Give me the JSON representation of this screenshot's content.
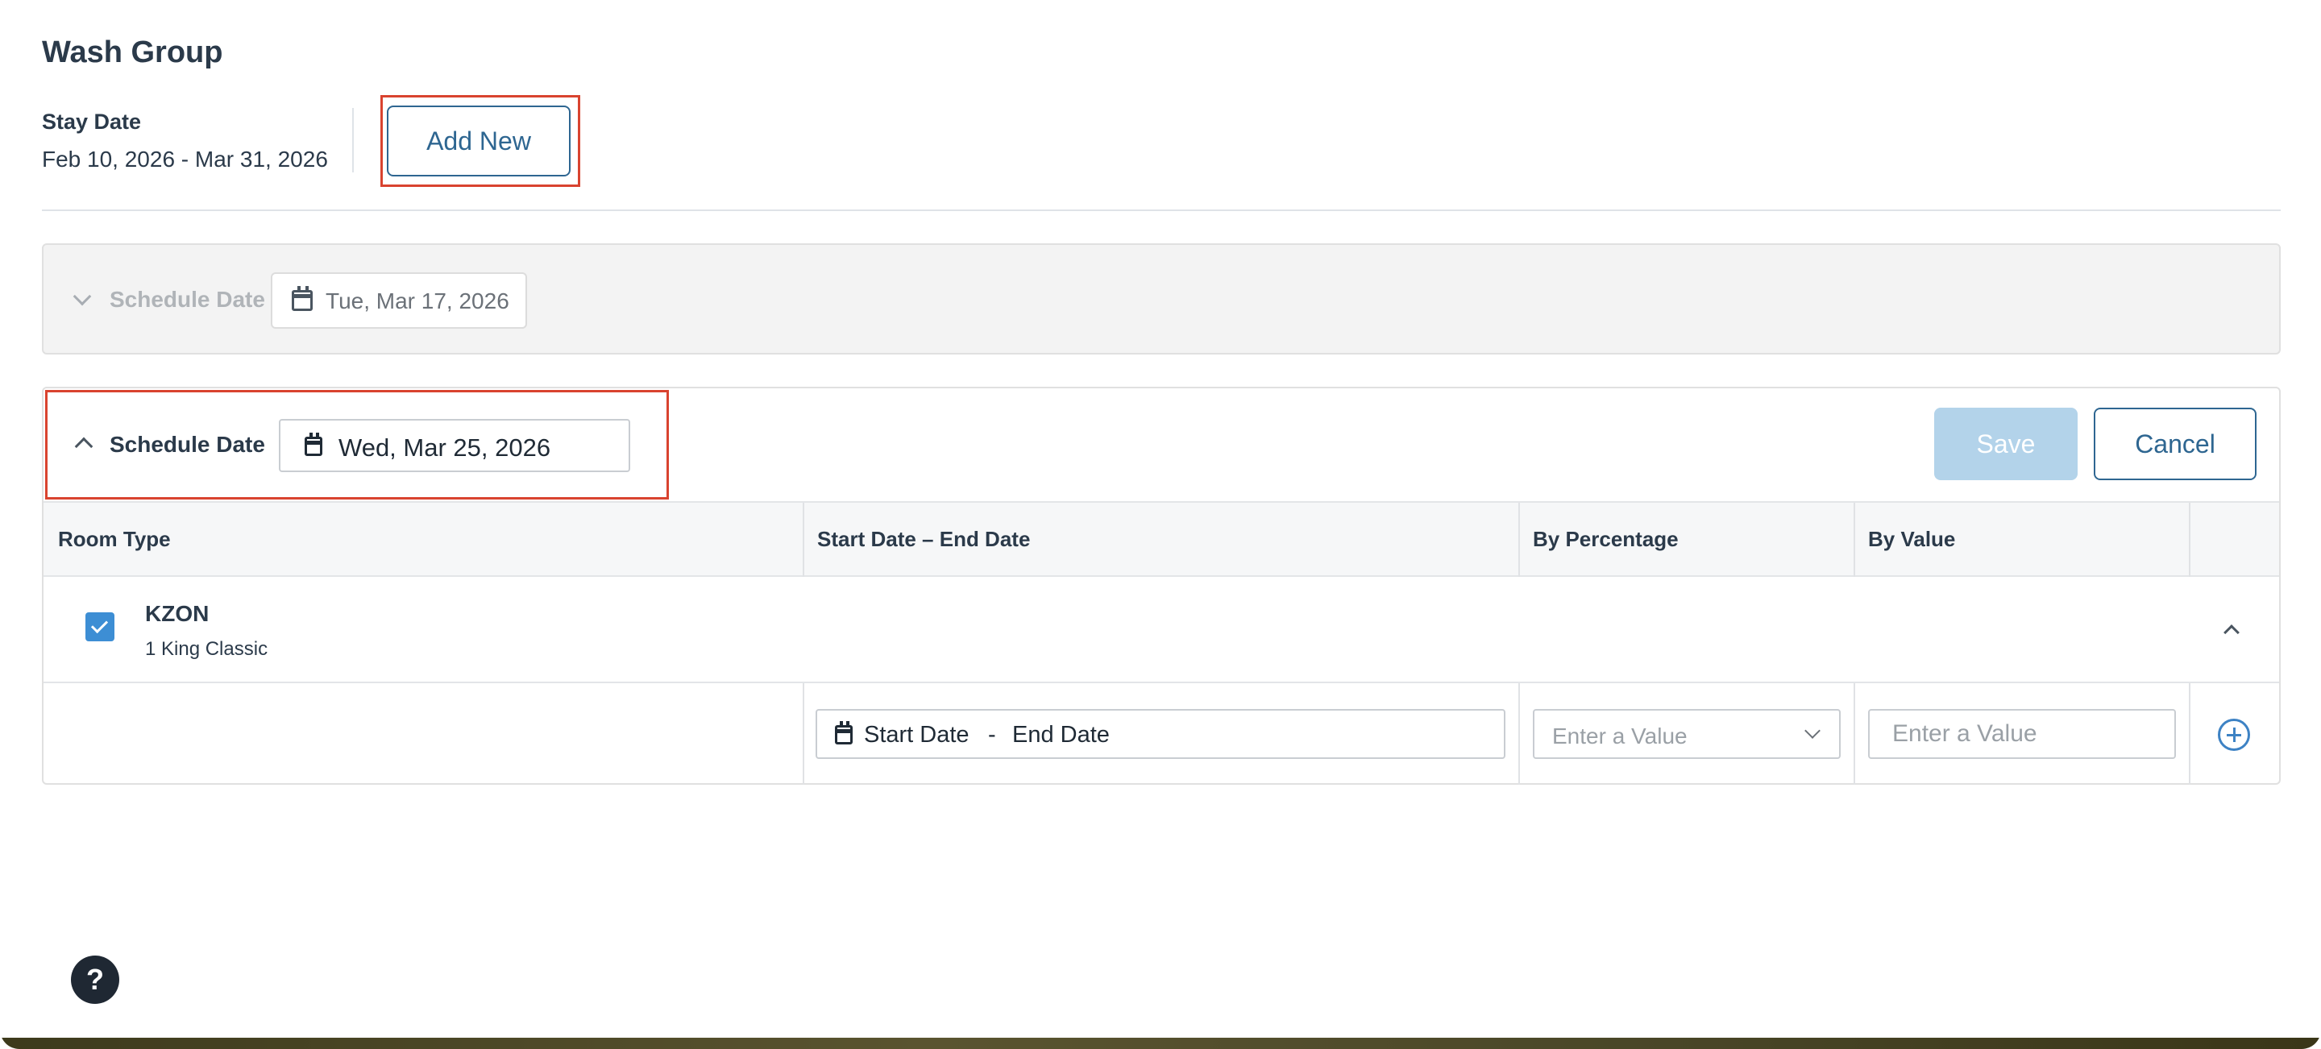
{
  "page": {
    "title": "Wash Group",
    "stay_date_label": "Stay Date",
    "stay_date_value": "Feb 10, 2026 - Mar 31, 2026",
    "add_new_label": "Add New"
  },
  "schedules": [
    {
      "label": "Schedule Date",
      "date": "Tue, Mar 17, 2026",
      "state": "collapsed"
    },
    {
      "label": "Schedule Date",
      "date": "Wed, Mar 25, 2026",
      "state": "expanded",
      "save_label": "Save",
      "cancel_label": "Cancel",
      "table": {
        "headers": [
          "Room Type",
          "Start Date – End Date",
          "By Percentage",
          "By Value"
        ],
        "rooms": [
          {
            "code": "KZON",
            "name": "1 King Classic",
            "checked": true,
            "start_placeholder": "Start Date",
            "range_separator": "-",
            "end_placeholder": "End Date",
            "percentage_placeholder": "Enter a Value",
            "value_placeholder": "Enter a Value"
          }
        ]
      }
    }
  ],
  "help": {
    "label": "?"
  },
  "colors": {
    "primary": "#2e6691",
    "save_disabled": "#b3d3ea",
    "checkbox": "#3d8ed4",
    "highlight": "#d9432f"
  },
  "icons": [
    "calendar-icon",
    "chevron-down-icon",
    "chevron-up-icon",
    "check-icon",
    "add-circle-icon",
    "help-icon"
  ]
}
